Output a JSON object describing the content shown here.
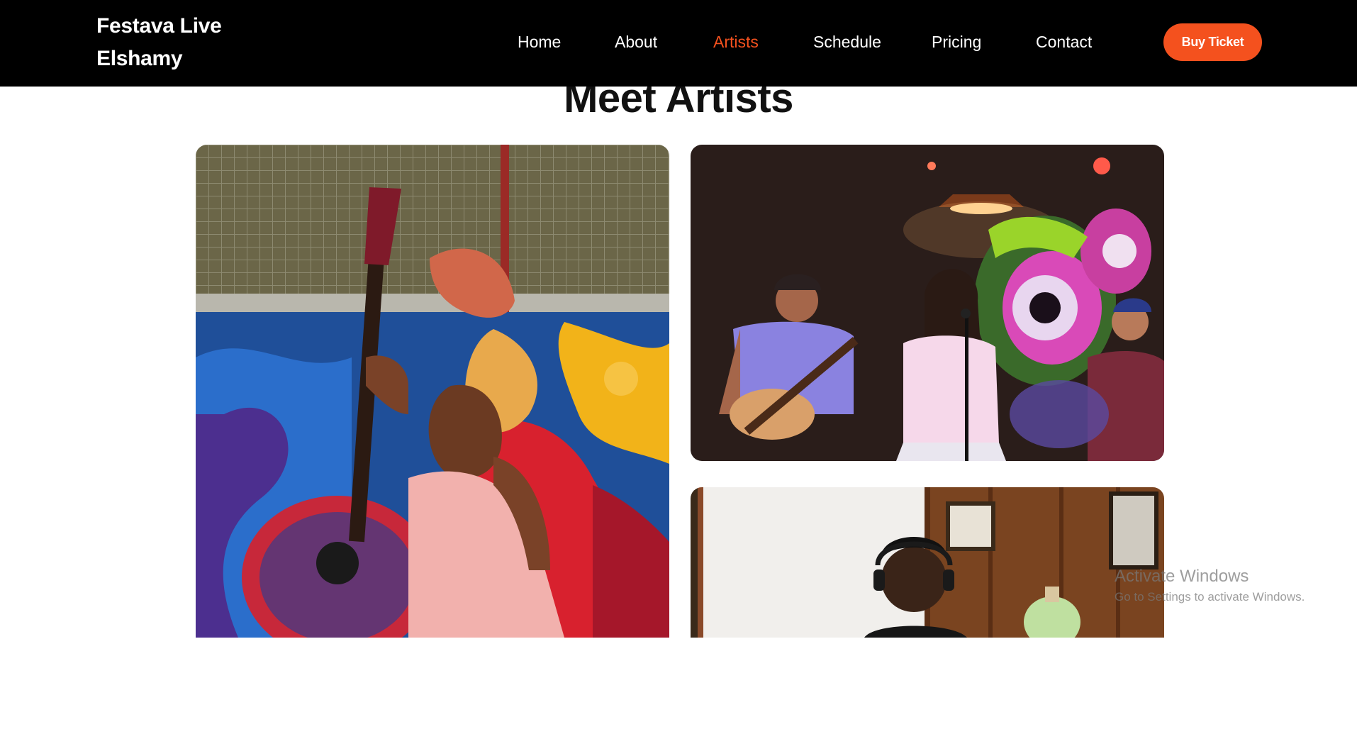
{
  "brand": {
    "line1": "Festava Live",
    "line2": "Elshamy"
  },
  "nav": {
    "items": [
      {
        "label": "Home"
      },
      {
        "label": "About"
      },
      {
        "label": "Artists",
        "active": true
      },
      {
        "label": "Schedule"
      },
      {
        "label": "Pricing"
      },
      {
        "label": "Contact"
      }
    ],
    "buy_label": "Buy Ticket"
  },
  "section": {
    "title": "Meet Artists"
  },
  "watermark": {
    "title": "Activate Windows",
    "subtitle": "Go to Settings to activate Windows."
  },
  "colors": {
    "navbar_bg": "#000000",
    "accent": "#f4511e",
    "text_light": "#ffffff",
    "heading": "#111111"
  }
}
